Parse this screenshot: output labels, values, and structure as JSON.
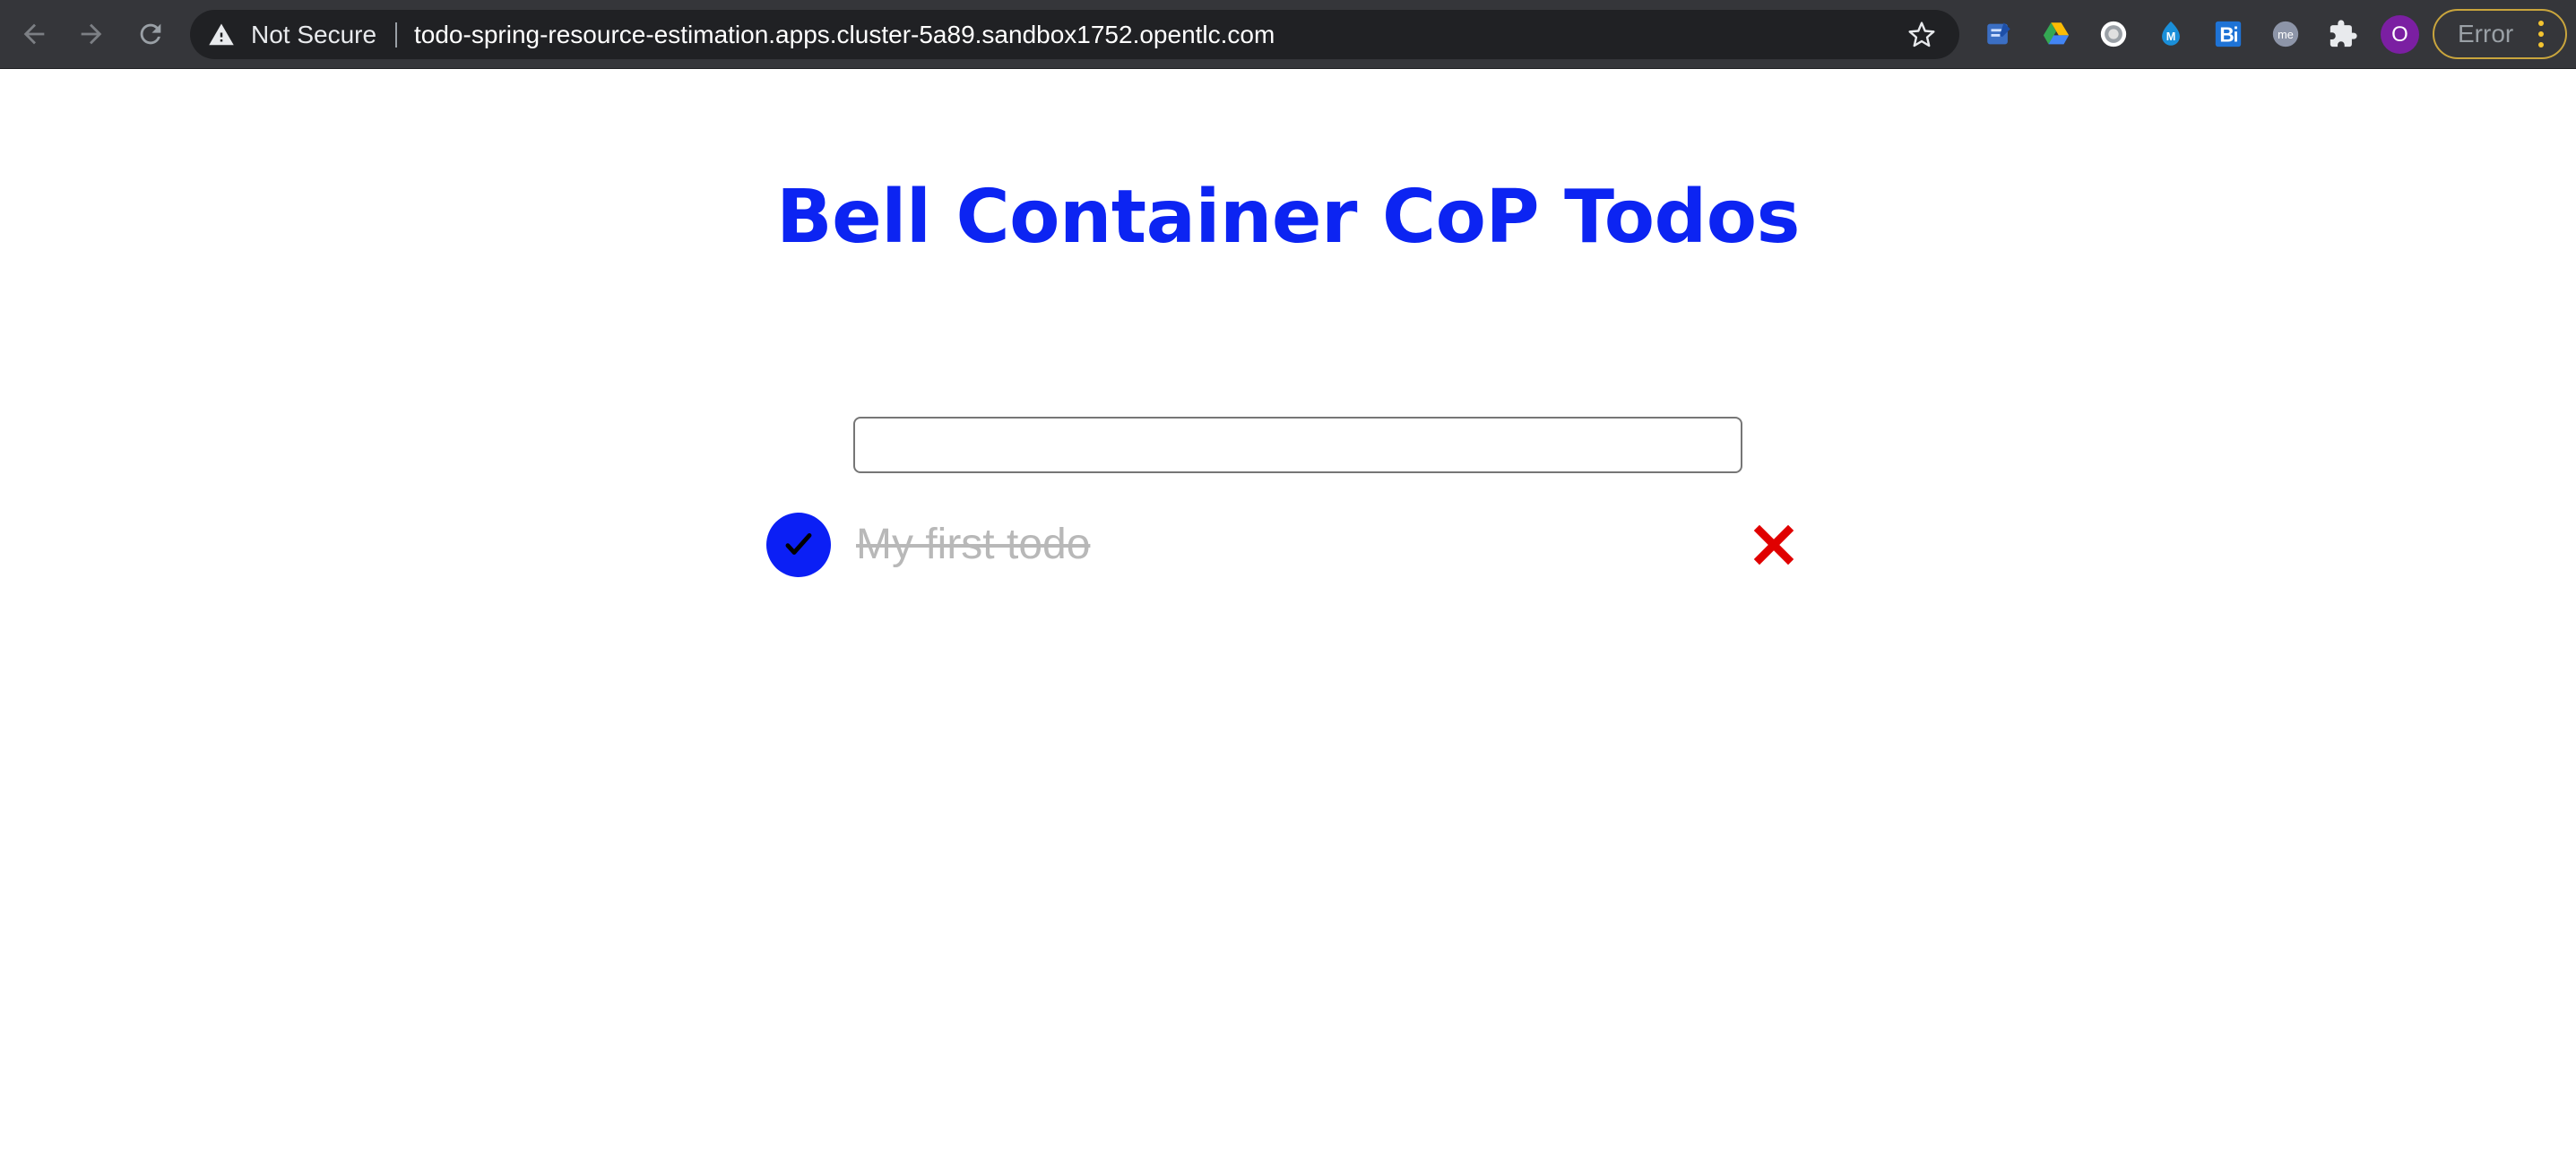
{
  "browser": {
    "security_label": "Not Secure",
    "url": "todo-spring-resource-estimation.apps.cluster-5a89.sandbox1752.opentlc.com",
    "profile_initial": "O",
    "error_label": "Error",
    "extensions": [
      "notes-extension-icon",
      "google-drive-icon",
      "circle-extension-icon",
      "m-extension-icon",
      "b-extension-icon",
      "me-extension-icon",
      "puzzle-extensions-icon"
    ],
    "ext_texts": {
      "m": "M",
      "b": "B",
      "me": "me"
    }
  },
  "app": {
    "title": "Bell Container CoP Todos",
    "input": {
      "value": "",
      "placeholder": ""
    },
    "todos": [
      {
        "text": "My first todo",
        "completed": true
      }
    ]
  },
  "colors": {
    "title": "#0c24f2",
    "toggle_bg": "#0b1ff5",
    "completed_text": "#b8b8b8",
    "delete": "#e00000",
    "chrome_bg": "#35363a",
    "omnibox_bg": "#202124",
    "avatar_bg": "#7b1fa2",
    "error_border": "#c9a53d"
  }
}
